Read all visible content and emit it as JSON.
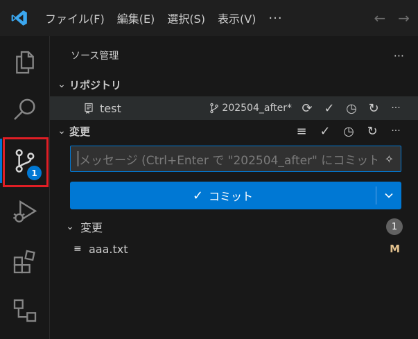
{
  "titlebar": {
    "menus": [
      "ファイル(F)",
      "編集(E)",
      "選択(S)",
      "表示(V)"
    ],
    "more": "···",
    "back": "←",
    "forward": "→"
  },
  "activity": {
    "scm_badge": "1"
  },
  "sidebar": {
    "title": "ソース管理",
    "more": "···",
    "repositories": {
      "header": "リポジトリ",
      "repo_name": "test",
      "branch": "202504_after*"
    },
    "changes_section": {
      "header": "変更",
      "commit_placeholder": "メッセージ (Ctrl+Enter で \"202504_after\" にコミット)",
      "commit_label": "コミット",
      "group_label": "変更",
      "group_count": "1",
      "files": [
        {
          "name": "aaa.txt",
          "status": "M"
        }
      ]
    }
  },
  "colors": {
    "accent": "#0078d4",
    "highlight": "#e01e25",
    "modified": "#e2c08d"
  }
}
